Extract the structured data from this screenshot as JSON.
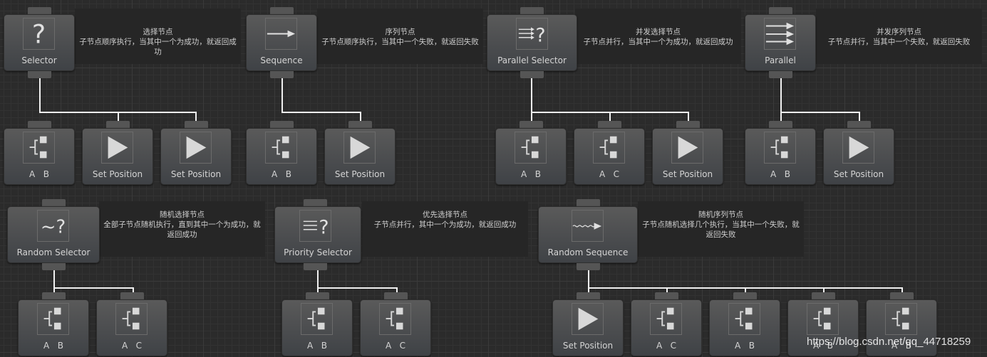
{
  "roots": [
    {
      "label": "Selector",
      "icon": "question-icon",
      "title": "选择节点",
      "desc": "子节点顺序执行，当其中一个为成功，就返回成功"
    },
    {
      "label": "Sequence",
      "icon": "arrow-right-icon",
      "title": "序列节点",
      "desc": "子节点顺序执行，当其中一个失败，就返回失败"
    },
    {
      "label": "Parallel Selector",
      "icon": "parallel-question-icon",
      "title": "并发选择节点",
      "desc": "子节点并行，当其中一个为成功，就返回成功"
    },
    {
      "label": "Parallel",
      "icon": "parallel-arrows-icon",
      "title": "并发序列节点",
      "desc": "子节点并行，当其中一个失败，就返回失败"
    },
    {
      "label": "Random Selector",
      "icon": "random-question-icon",
      "title": "随机选择节点",
      "desc": "全部子节点随机执行，直到其中一个为成功，就返回成功"
    },
    {
      "label": "Priority Selector",
      "icon": "priority-question-icon",
      "title": "优先选择节点",
      "desc": "子节点并行，其中一个为成功，就返回成功"
    },
    {
      "label": "Random Sequence",
      "icon": "random-arrow-icon",
      "title": "随机序列节点",
      "desc": "子节点随机选择几个执行，当其中一个失败，就返回失败"
    }
  ],
  "children": {
    "selector": [
      {
        "label": "A   B",
        "icon": "branch-icon"
      },
      {
        "label": "Set Position",
        "icon": "play-icon"
      },
      {
        "label": "Set Position",
        "icon": "play-icon"
      }
    ],
    "sequence": [
      {
        "label": "A   B",
        "icon": "branch-icon"
      },
      {
        "label": "Set Position",
        "icon": "play-icon"
      }
    ],
    "parallel_selector": [
      {
        "label": "A   B",
        "icon": "branch-icon"
      },
      {
        "label": "A   C",
        "icon": "branch-icon"
      },
      {
        "label": "Set Position",
        "icon": "play-icon"
      }
    ],
    "parallel": [
      {
        "label": "A   B",
        "icon": "branch-icon"
      },
      {
        "label": "Set Position",
        "icon": "play-icon"
      }
    ],
    "random_selector": [
      {
        "label": "A   B",
        "icon": "branch-icon"
      },
      {
        "label": "A   C",
        "icon": "branch-icon"
      }
    ],
    "priority_selector": [
      {
        "label": "A   B",
        "icon": "branch-icon"
      },
      {
        "label": "A   C",
        "icon": "branch-icon"
      }
    ],
    "random_sequence": [
      {
        "label": "Set Position",
        "icon": "play-icon"
      },
      {
        "label": "A   C",
        "icon": "branch-icon"
      },
      {
        "label": "A   B",
        "icon": "branch-icon"
      },
      {
        "label": "A   B",
        "icon": "branch-icon"
      },
      {
        "label": "A   B",
        "icon": "branch-icon"
      }
    ]
  },
  "watermark": "https://blog.csdn.net/qq_44718259"
}
